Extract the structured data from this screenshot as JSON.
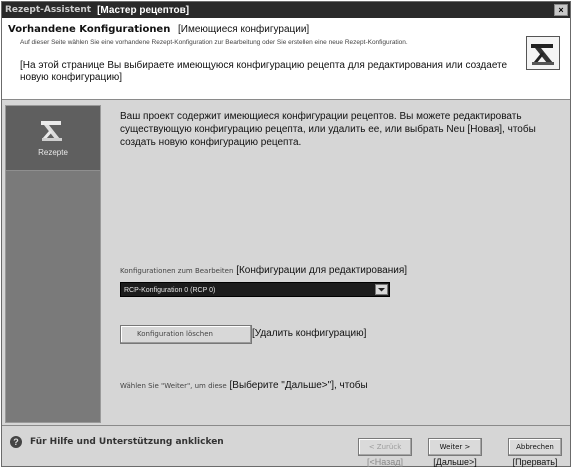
{
  "window": {
    "title_de": "Rezept-Assistent",
    "title_ru": "[Мастер рецептов]",
    "close_glyph": "×"
  },
  "header": {
    "title_de": "Vorhandene Konfigurationen",
    "title_ru": "[Имеющиеся конфигурации]",
    "desc_de": "Auf dieser Seite wählen Sie eine vorhandene Rezept-Konfiguration zur Bearbeitung oder Sie erstellen eine neue Rezept-Konfiguration.",
    "desc_ru": "[На этой странице Вы выбираете имеющуюся конфигурацию рецепта для редактирования или создаете новую конфигурацию]",
    "icon": "recipe-wizard-icon"
  },
  "sidebar": {
    "items": [
      {
        "label": "Rezepte",
        "icon": "recipes-icon"
      }
    ]
  },
  "main": {
    "intro_ru": "Ваш проект содержит имеющиеся конфигурации рецептов. Вы можете редактировать существующую конфигурацию рецепта, или удалить ее, или выбрать Neu [Новая], чтобы создать новую конфигурацию рецепта.",
    "config_label_de": "Konfigurationen zum Bearbeiten",
    "config_label_ru": "[Конфигурации для редактирования]",
    "config_selected": "RCP-Konfiguration 0 (RCP 0)",
    "delete_button_de": "Konfiguration löschen",
    "delete_button_ru": "[Удалить конфигурацию]",
    "next_hint_de": "Wählen Sie \"Weiter\", um diese",
    "next_hint_ru": "[Выберите \"Дальше>\"], чтобы"
  },
  "footer": {
    "help_text": "Für Hilfe und Unterstützung anklicken",
    "back_label": "< Zurück",
    "back_ru": "[<Назад]",
    "next_label": "Weiter >",
    "next_ru": "[Дальше>]",
    "cancel_label": "Abbrechen",
    "cancel_ru": "[Прервать]"
  }
}
